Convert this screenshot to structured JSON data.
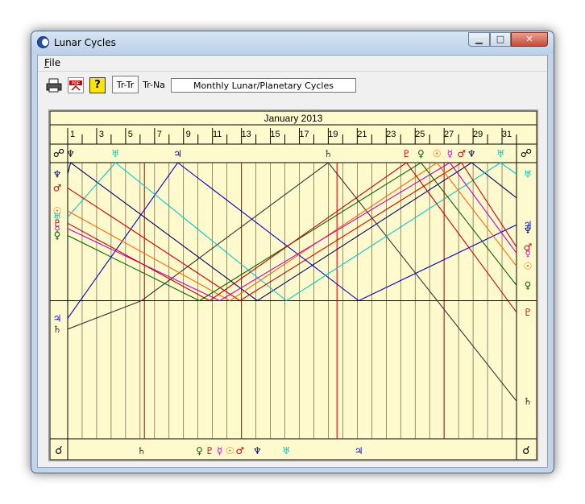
{
  "window": {
    "title": "Lunar Cycles",
    "min_icon": "minimize-icon",
    "max_icon": "maximize-icon",
    "close_icon": "close-icon"
  },
  "menu": {
    "file_initial": "F",
    "file_rest": "ile"
  },
  "toolbar": {
    "print_icon": "printer-icon",
    "pdf_icon": "pdf-icon",
    "help_label": "?",
    "seg_trtr": "Tr-Tr",
    "seg_trna": "Tr-Na",
    "caption": "Monthly Lunar/Planetary Cycles"
  },
  "chart_data": {
    "type": "line",
    "title": "January  2013",
    "x_ticks": [
      "1",
      "3",
      "5",
      "7",
      "9",
      "11",
      "13",
      "15",
      "17",
      "19",
      "21",
      "23",
      "25",
      "27",
      "29",
      "31"
    ],
    "xlim": [
      1,
      32
    ],
    "top_label": "☍",
    "bottom_label": "☌",
    "colors": {
      "moon": "#000000",
      "pluto": "#c00000",
      "mars": "#d00000",
      "neptune": "#000066",
      "uranus": "#00c8c8",
      "sun": "#ff6600",
      "mercury": "#c000c0",
      "venus": "#006400",
      "saturn": "#333333",
      "jupiter": "#0000cc"
    },
    "opposition_markers": [
      {
        "glyph": "♆",
        "day": 1.2,
        "color": "#000066"
      },
      {
        "glyph": "♅",
        "day": 4.3,
        "color": "#00c8c8"
      },
      {
        "glyph": "♃",
        "day": 8.6,
        "color": "#0000cc"
      },
      {
        "glyph": "♄",
        "day": 19.0,
        "color": "#333333"
      },
      {
        "glyph": "♇",
        "day": 24.4,
        "color": "#c00000"
      },
      {
        "glyph": "♀",
        "day": 25.4,
        "color": "#006400"
      },
      {
        "glyph": "☉",
        "day": 26.5,
        "color": "#ff6600"
      },
      {
        "glyph": "☿",
        "day": 27.4,
        "color": "#c000c0"
      },
      {
        "glyph": "♂",
        "day": 28.2,
        "color": "#d00000"
      },
      {
        "glyph": "♆",
        "day": 28.9,
        "color": "#000066"
      },
      {
        "glyph": "♅",
        "day": 30.9,
        "color": "#00c8c8"
      }
    ],
    "conjunction_markers": [
      {
        "glyph": "♄",
        "day": 6.1,
        "color": "#333333"
      },
      {
        "glyph": "♀",
        "day": 10.1,
        "color": "#006400"
      },
      {
        "glyph": "♇",
        "day": 10.8,
        "color": "#c00000"
      },
      {
        "glyph": "☿",
        "day": 11.5,
        "color": "#c000c0"
      },
      {
        "glyph": "☉",
        "day": 12.2,
        "color": "#ff6600"
      },
      {
        "glyph": "♂",
        "day": 12.9,
        "color": "#d00000"
      },
      {
        "glyph": "♆",
        "day": 14.1,
        "color": "#000066"
      },
      {
        "glyph": "♅",
        "day": 16.1,
        "color": "#00c8c8"
      },
      {
        "glyph": "♃",
        "day": 21.1,
        "color": "#0000cc"
      }
    ],
    "left_axis_labels": [
      {
        "glyph": "♆",
        "deg": 165,
        "color": "#000066"
      },
      {
        "glyph": "♂",
        "deg": 147,
        "color": "#d00000"
      },
      {
        "glyph": "☉",
        "deg": 117,
        "color": "#ff6600"
      },
      {
        "glyph": "♅",
        "deg": 109,
        "color": "#00c8c8"
      },
      {
        "glyph": "♇",
        "deg": 101,
        "color": "#c00000"
      },
      {
        "glyph": "☿",
        "deg": 94,
        "color": "#c000c0"
      },
      {
        "glyph": "♀",
        "deg": 85,
        "color": "#006400"
      },
      {
        "glyph": "♃",
        "deg": -23,
        "color": "#0000cc"
      },
      {
        "glyph": "♄",
        "deg": -37,
        "color": "#333333"
      }
    ],
    "right_axis_labels": [
      {
        "glyph": "♅",
        "deg": 165,
        "color": "#00c8c8"
      },
      {
        "glyph": "♃",
        "deg": 99,
        "color": "#0000cc"
      },
      {
        "glyph": "♆",
        "deg": 92,
        "color": "#000066"
      },
      {
        "glyph": "♂",
        "deg": 70,
        "color": "#d00000"
      },
      {
        "glyph": "☿",
        "deg": 62,
        "color": "#c000c0"
      },
      {
        "glyph": "☉",
        "deg": 45,
        "color": "#ff6600"
      },
      {
        "glyph": "♀",
        "deg": 20,
        "color": "#006400"
      },
      {
        "glyph": "♇",
        "deg": -15,
        "color": "#c00000"
      },
      {
        "glyph": "♄",
        "deg": -131,
        "color": "#333333"
      }
    ],
    "red_gridlines_days": [
      6.3,
      13.0,
      19.6,
      27.0
    ],
    "series": [
      {
        "points": [
          [
            1.0,
            165
          ],
          [
            1.2,
            180
          ],
          [
            14.1,
            0
          ],
          [
            28.9,
            180
          ],
          [
            32,
            134
          ]
        ],
        "color": "#000066"
      },
      {
        "points": [
          [
            1.0,
            -37
          ],
          [
            6.1,
            0
          ],
          [
            19.0,
            180
          ],
          [
            32,
            -131
          ]
        ],
        "color": "#333333"
      },
      {
        "points": [
          [
            1.0,
            -23
          ],
          [
            8.6,
            180
          ],
          [
            21.1,
            0
          ],
          [
            32,
            99
          ]
        ],
        "color": "#0000cc"
      },
      {
        "points": [
          [
            1.0,
            109
          ],
          [
            4.3,
            180
          ],
          [
            16.1,
            0
          ],
          [
            30.9,
            180
          ],
          [
            32,
            165
          ]
        ],
        "color": "#00c8c8"
      },
      {
        "points": [
          [
            1.0,
            147
          ],
          [
            12.9,
            0
          ],
          [
            28.2,
            180
          ],
          [
            32,
            70
          ]
        ],
        "color": "#d00000"
      },
      {
        "points": [
          [
            1.0,
            117
          ],
          [
            12.2,
            0
          ],
          [
            26.5,
            180
          ],
          [
            32,
            45
          ]
        ],
        "color": "#ff6600"
      },
      {
        "points": [
          [
            1.0,
            94
          ],
          [
            11.5,
            0
          ],
          [
            27.4,
            180
          ],
          [
            32,
            62
          ]
        ],
        "color": "#c000c0"
      },
      {
        "points": [
          [
            1.0,
            85
          ],
          [
            10.1,
            0
          ],
          [
            25.4,
            180
          ],
          [
            32,
            20
          ]
        ],
        "color": "#006400"
      },
      {
        "points": [
          [
            1.0,
            101
          ],
          [
            10.8,
            0
          ],
          [
            24.4,
            180
          ],
          [
            32,
            -15
          ]
        ],
        "color": "#c00000"
      }
    ]
  }
}
